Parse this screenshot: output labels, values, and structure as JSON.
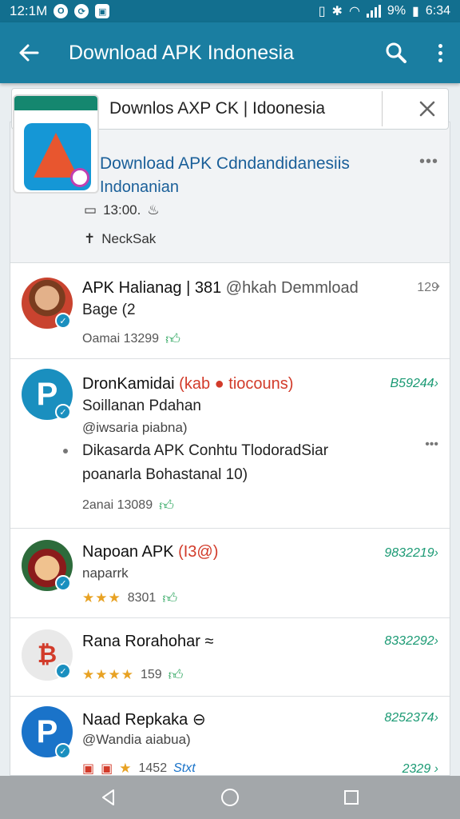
{
  "status_bar": {
    "time": "12:1M",
    "battery": "9%",
    "clock": "6:34"
  },
  "app_bar": {
    "title": "Download APK Indonesia"
  },
  "search": {
    "value": "Downlos AXP CK | Idoonesia"
  },
  "featured": {
    "title": "Download APK Cdndandidanesiis",
    "subtitle": "Indonanian",
    "meta": "13:00.",
    "tag": "NeckSak",
    "more": "•••"
  },
  "rows": [
    {
      "title": "APK Halianag | 381",
      "title_extra": "@hkah Demmload",
      "line2": "Bage (2",
      "meta": "Oamai 13299",
      "value": "129"
    },
    {
      "title": "DronKamidai",
      "title_extra": "(kab ● tiocouns)",
      "line2": "Soillanan Pdahan",
      "line3": "@iwsaria piabna)",
      "bullet_line1": "Dikasarda APK Conhtu TlodoradSiar",
      "bullet_line2": "poanarla Bohastanal 10)",
      "meta": "2anai 13089",
      "value": "B59244›",
      "more": "•••"
    },
    {
      "title": "Napoan APK",
      "title_extra": "(I3@)",
      "line2": "naparrk",
      "stars": "★★★",
      "meta": "8301",
      "value": "9832219›"
    },
    {
      "title": "Rana Rorahohar",
      "title_extra": "≈",
      "stars": "★★★★",
      "meta": "159",
      "value": "8332292›"
    },
    {
      "title": "Naad Repkaka",
      "title_extra": "⊖",
      "line2": "@Wandia aiabua)",
      "stars": "★",
      "meta": "1452",
      "meta_extra": "Stxt",
      "value": "8252374›"
    },
    {
      "value": "2329 ›"
    }
  ],
  "colors": {
    "app_bar": "#1a7ea1",
    "status_bar": "#126f8f",
    "link_blue": "#1a5f99",
    "value_green": "#1b9a74",
    "star": "#e8a223",
    "nav_bar": "#a3a7aa"
  }
}
